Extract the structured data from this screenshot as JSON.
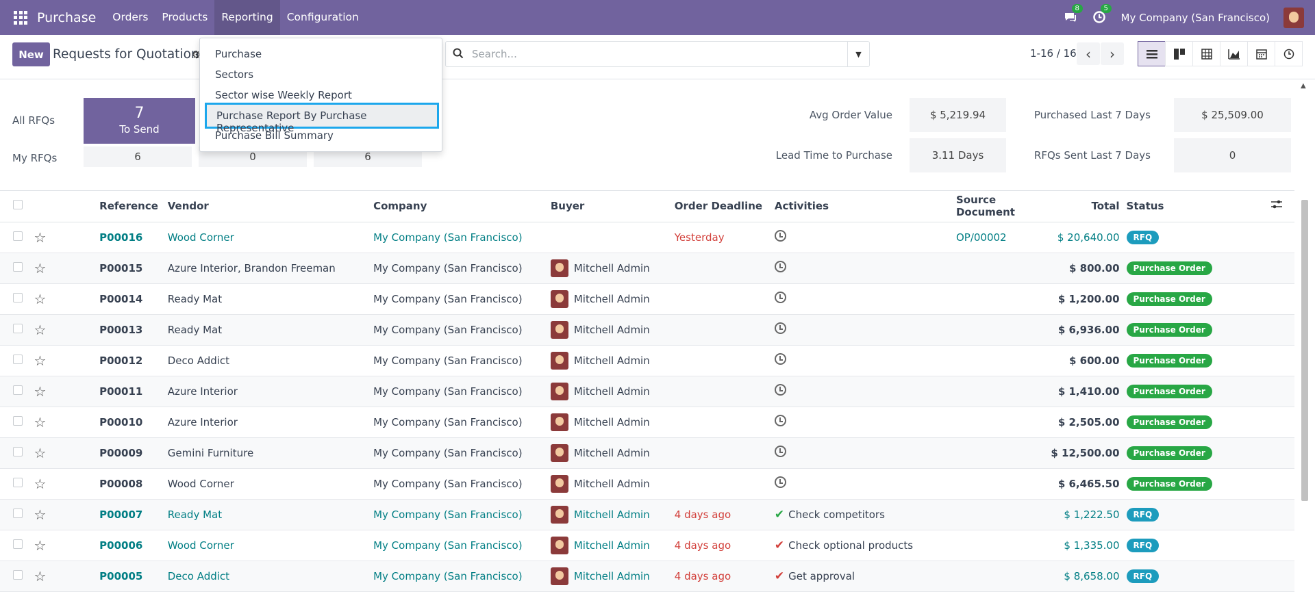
{
  "topbar": {
    "app_name": "Purchase",
    "menu": [
      "Orders",
      "Products",
      "Reporting",
      "Configuration"
    ],
    "messages_count": "8",
    "activities_count": "5",
    "company": "My Company (San Francisco)"
  },
  "control": {
    "new_label": "New",
    "title": "Requests for Quotation",
    "search_placeholder": "Search...",
    "pager": "1-16 / 16"
  },
  "reporting_menu": {
    "items": [
      "Purchase",
      "Sectors",
      "Sector wise Weekly Report",
      "Purchase Report By Purchase Representative",
      "Purchase Bill Summary"
    ]
  },
  "dashboard": {
    "all_rfqs_label": "All RFQs",
    "my_rfqs_label": "My RFQs",
    "to_send_count": "7",
    "to_send_label": "To Send",
    "my_counts": [
      "6",
      "0",
      "6"
    ],
    "avg_order_label": "Avg Order Value",
    "avg_order_value": "$ 5,219.94",
    "lead_time_label": "Lead Time to Purchase",
    "lead_time_value": "3.11 Days",
    "purchased_label": "Purchased Last 7 Days",
    "purchased_value": "$ 25,509.00",
    "rfqs_sent_label": "RFQs Sent Last 7 Days",
    "rfqs_sent_value": "0"
  },
  "table": {
    "headers": [
      "Reference",
      "Vendor",
      "Company",
      "Buyer",
      "Order Deadline",
      "Activities",
      "Source Document",
      "Total",
      "Status"
    ],
    "rows": [
      {
        "ref": "P00016",
        "vendor": "Wood Corner",
        "company": "My Company (San Francisco)",
        "buyer": "",
        "deadline": "Yesterday",
        "activity": "",
        "source": "OP/00002",
        "total": "$ 20,640.00",
        "status": "RFQ"
      },
      {
        "ref": "P00015",
        "vendor": "Azure Interior, Brandon Freeman",
        "company": "My Company (San Francisco)",
        "buyer": "Mitchell Admin",
        "deadline": "",
        "activity": "",
        "source": "",
        "total": "$ 800.00",
        "status": "Purchase Order"
      },
      {
        "ref": "P00014",
        "vendor": "Ready Mat",
        "company": "My Company (San Francisco)",
        "buyer": "Mitchell Admin",
        "deadline": "",
        "activity": "",
        "source": "",
        "total": "$ 1,200.00",
        "status": "Purchase Order"
      },
      {
        "ref": "P00013",
        "vendor": "Ready Mat",
        "company": "My Company (San Francisco)",
        "buyer": "Mitchell Admin",
        "deadline": "",
        "activity": "",
        "source": "",
        "total": "$ 6,936.00",
        "status": "Purchase Order"
      },
      {
        "ref": "P00012",
        "vendor": "Deco Addict",
        "company": "My Company (San Francisco)",
        "buyer": "Mitchell Admin",
        "deadline": "",
        "activity": "",
        "source": "",
        "total": "$ 600.00",
        "status": "Purchase Order"
      },
      {
        "ref": "P00011",
        "vendor": "Azure Interior",
        "company": "My Company (San Francisco)",
        "buyer": "Mitchell Admin",
        "deadline": "",
        "activity": "",
        "source": "",
        "total": "$ 1,410.00",
        "status": "Purchase Order"
      },
      {
        "ref": "P00010",
        "vendor": "Azure Interior",
        "company": "My Company (San Francisco)",
        "buyer": "Mitchell Admin",
        "deadline": "",
        "activity": "",
        "source": "",
        "total": "$ 2,505.00",
        "status": "Purchase Order"
      },
      {
        "ref": "P00009",
        "vendor": "Gemini Furniture",
        "company": "My Company (San Francisco)",
        "buyer": "Mitchell Admin",
        "deadline": "",
        "activity": "",
        "source": "",
        "total": "$ 12,500.00",
        "status": "Purchase Order"
      },
      {
        "ref": "P00008",
        "vendor": "Wood Corner",
        "company": "My Company (San Francisco)",
        "buyer": "Mitchell Admin",
        "deadline": "",
        "activity": "",
        "source": "",
        "total": "$ 6,465.50",
        "status": "Purchase Order"
      },
      {
        "ref": "P00007",
        "vendor": "Ready Mat",
        "company": "My Company (San Francisco)",
        "buyer": "Mitchell Admin",
        "deadline": "4 days ago",
        "activity": "Check competitors",
        "source": "",
        "total": "$ 1,222.50",
        "status": "RFQ"
      },
      {
        "ref": "P00006",
        "vendor": "Wood Corner",
        "company": "My Company (San Francisco)",
        "buyer": "Mitchell Admin",
        "deadline": "4 days ago",
        "activity": "Check optional products",
        "source": "",
        "total": "$ 1,335.00",
        "status": "RFQ"
      },
      {
        "ref": "P00005",
        "vendor": "Deco Addict",
        "company": "My Company (San Francisco)",
        "buyer": "Mitchell Admin",
        "deadline": "4 days ago",
        "activity": "Get approval",
        "source": "",
        "total": "$ 8,658.00",
        "status": "RFQ"
      }
    ]
  }
}
